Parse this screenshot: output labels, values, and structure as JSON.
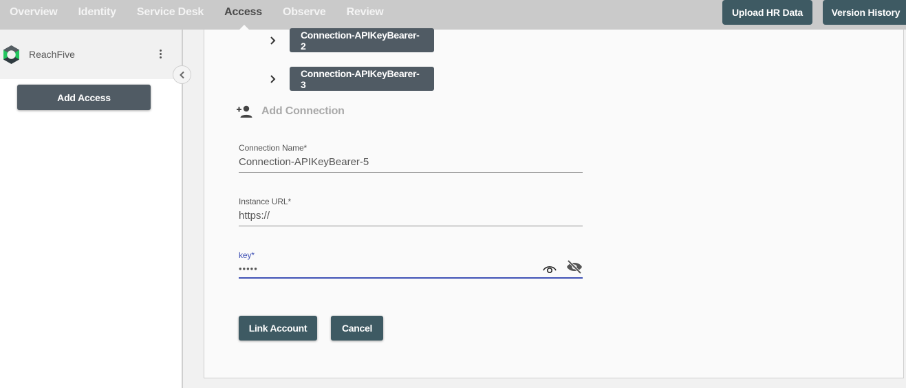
{
  "nav": {
    "items": [
      {
        "label": "Overview",
        "active": false
      },
      {
        "label": "Identity",
        "active": false
      },
      {
        "label": "Service Desk",
        "active": false
      },
      {
        "label": "Access",
        "active": true
      },
      {
        "label": "Observe",
        "active": false
      },
      {
        "label": "Review",
        "active": false
      }
    ],
    "upload_hr_data": "Upload HR Data",
    "version_history": "Version History"
  },
  "sidebar": {
    "org_name": "ReachFive",
    "add_access_label": "Add Access",
    "icons": {
      "logo": "reachfive-logo",
      "menu": "more-vertical-icon",
      "collapse": "chevron-left-icon"
    }
  },
  "connections": [
    {
      "name": "Connection-APIKeyBearer-2"
    },
    {
      "name": "Connection-APIKeyBearer-3"
    }
  ],
  "add_connection": {
    "label": "Add Connection",
    "icon": "person-add-icon"
  },
  "form": {
    "connection_name": {
      "label": "Connection Name*",
      "value": "Connection-APIKeyBearer-5"
    },
    "instance_url": {
      "label": "Instance URL*",
      "value": "https://"
    },
    "key": {
      "label": "key*",
      "value": "•••••",
      "focused": true
    }
  },
  "actions": {
    "link_account": "Link Account",
    "cancel": "Cancel"
  },
  "colors": {
    "topbar": "#cacaca",
    "primary_button": "#3e5a63",
    "chip": "#505b64",
    "focus": "#3f51b5",
    "logo_green": "#2ecc71"
  }
}
